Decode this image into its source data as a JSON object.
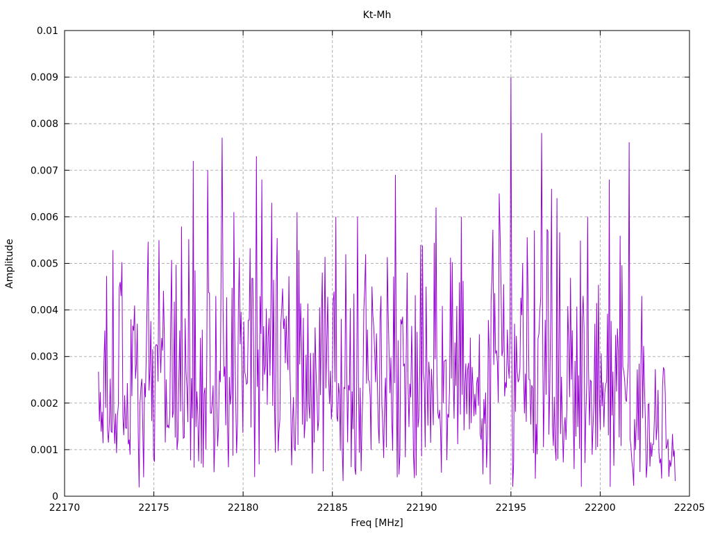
{
  "window": {
    "background": "#ffffff"
  },
  "chart_data": {
    "type": "line",
    "title": "Kt-Mh",
    "xlabel": "Freq [MHz]",
    "ylabel": "Amplitude",
    "xlim": [
      22170,
      22205
    ],
    "ylim": [
      0,
      0.01
    ],
    "xticks": [
      22170,
      22175,
      22180,
      22185,
      22190,
      22195,
      22200,
      22205
    ],
    "xtick_labels": [
      "22170",
      "22175",
      "22180",
      "22185",
      "22190",
      "22195",
      "22200",
      "22205"
    ],
    "yticks": [
      0,
      0.001,
      0.002,
      0.003,
      0.004,
      0.005,
      0.006,
      0.007,
      0.008,
      0.009,
      0.01
    ],
    "ytick_labels": [
      "0",
      "0.001",
      "0.002",
      "0.003",
      "0.004",
      "0.005",
      "0.006",
      "0.007",
      "0.008",
      "0.009",
      "0.01"
    ],
    "grid": true,
    "grid_style": "dashed",
    "grid_color": "#b0b0b0",
    "axis_color": "#000000",
    "line_color": "#9400d3",
    "background_color": "#ffffff",
    "legend": "none",
    "x_extent": [
      22171.9,
      22204.2
    ],
    "noise": {
      "model": "rayleigh",
      "n_points": 640,
      "seed": 20,
      "max_baseline": 0.0058,
      "sigma_envelope": [
        [
          22171.9,
          0.0016
        ],
        [
          22172.6,
          0.002
        ],
        [
          22180.0,
          0.0021
        ],
        [
          22190.0,
          0.0021
        ],
        [
          22199.0,
          0.0021
        ],
        [
          22201.8,
          0.0019
        ],
        [
          22202.6,
          0.0014
        ],
        [
          22203.4,
          0.001
        ],
        [
          22204.2,
          0.0006
        ]
      ]
    },
    "notable_peaks": [
      [
        22175.3,
        0.0055
      ],
      [
        22177.2,
        0.0072
      ],
      [
        22178.0,
        0.007
      ],
      [
        22178.8,
        0.0077
      ],
      [
        22179.5,
        0.0061
      ],
      [
        22180.75,
        0.0073
      ],
      [
        22181.05,
        0.0068
      ],
      [
        22181.6,
        0.0063
      ],
      [
        22183.0,
        0.0061
      ],
      [
        22185.2,
        0.006
      ],
      [
        22186.4,
        0.006
      ],
      [
        22188.55,
        0.0069
      ],
      [
        22190.8,
        0.0062
      ],
      [
        22192.2,
        0.006
      ],
      [
        22194.35,
        0.0065
      ],
      [
        22195.0,
        0.009
      ],
      [
        22196.7,
        0.0078
      ],
      [
        22197.3,
        0.0066
      ],
      [
        22197.6,
        0.0064
      ],
      [
        22199.3,
        0.006
      ],
      [
        22200.5,
        0.0068
      ],
      [
        22201.6,
        0.0076
      ]
    ]
  }
}
